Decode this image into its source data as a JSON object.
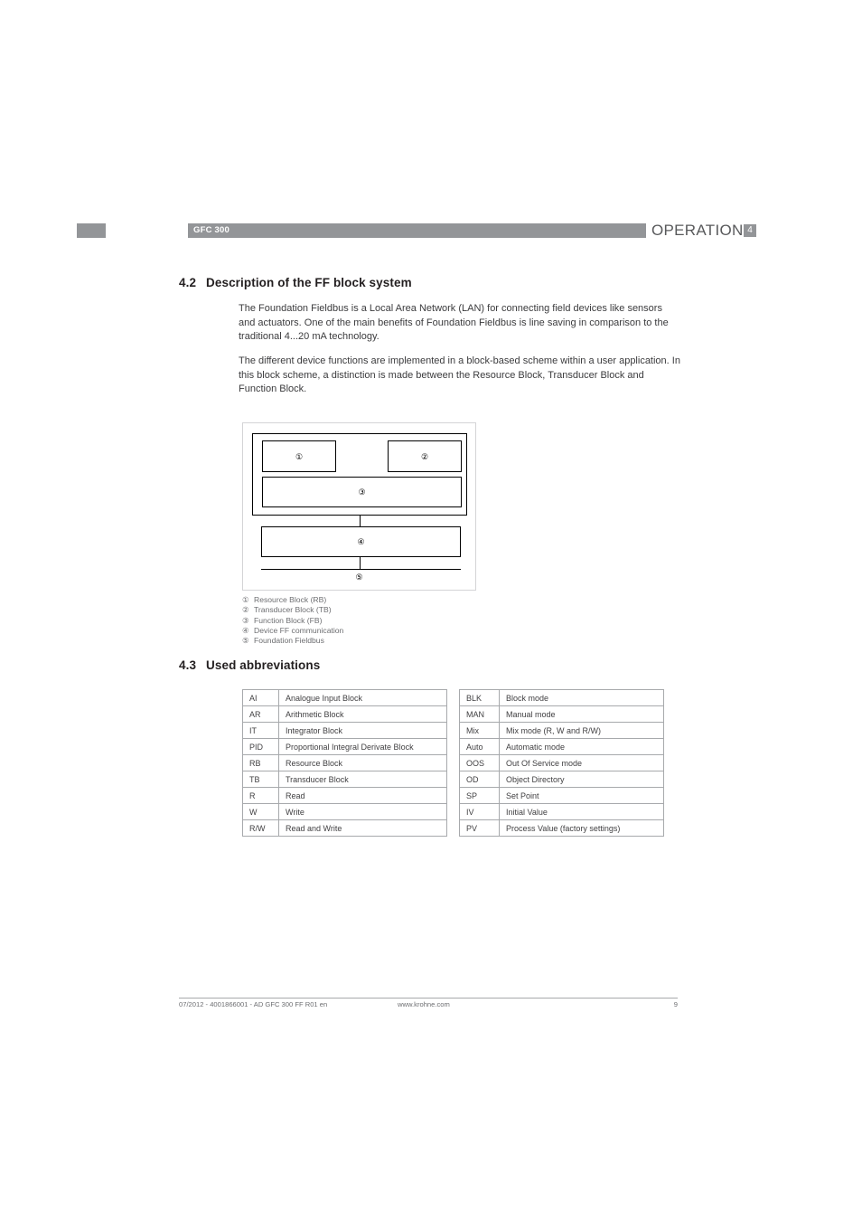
{
  "header": {
    "doc_title": "GFC 300",
    "section_title": "OPERATION",
    "chapter_number": "4",
    "bar_color": "#939598",
    "text_color": "#58595b"
  },
  "sections": {
    "s42": {
      "number": "4.2",
      "title": "Description of the FF block system",
      "paragraph_1": "The Foundation Fieldbus is a Local Area Network (LAN) for connecting field devices like sensors and actuators. One of the main benefits of Foundation Fieldbus is line saving in comparison to the traditional 4...20 mA technology.",
      "paragraph_2": "The different device functions are implemented in a block-based scheme within a user application. In this block scheme, a distinction is made between the Resource Block, Transducer Block and Function Block."
    },
    "s43": {
      "number": "4.3",
      "title": "Used abbreviations"
    }
  },
  "diagram": {
    "blocks": {
      "resource_block": "①",
      "transducer_block": "②",
      "function_block": "③",
      "device_ff_communication": "④",
      "foundation_fieldbus": "⑤"
    },
    "legend": [
      {
        "marker": "①",
        "label": "Resource Block (RB)"
      },
      {
        "marker": "②",
        "label": "Transducer Block (TB)"
      },
      {
        "marker": "③",
        "label": "Function Block (FB)"
      },
      {
        "marker": "④",
        "label": "Device FF communication"
      },
      {
        "marker": "⑤",
        "label": "Foundation Fieldbus"
      }
    ]
  },
  "abbreviations": {
    "left": [
      {
        "key": "AI",
        "value": "Analogue Input Block"
      },
      {
        "key": "AR",
        "value": "Arithmetic Block"
      },
      {
        "key": "IT",
        "value": "Integrator Block"
      },
      {
        "key": "PID",
        "value": "Proportional Integral Derivate Block"
      },
      {
        "key": "RB",
        "value": "Resource Block"
      },
      {
        "key": "TB",
        "value": "Transducer Block"
      },
      {
        "key": "R",
        "value": "Read"
      },
      {
        "key": "W",
        "value": "Write"
      },
      {
        "key": "R/W",
        "value": "Read and Write"
      }
    ],
    "right": [
      {
        "key": "BLK",
        "value": "Block mode"
      },
      {
        "key": "MAN",
        "value": "Manual mode"
      },
      {
        "key": "Mix",
        "value": "Mix mode (R, W and R/W)"
      },
      {
        "key": "Auto",
        "value": "Automatic mode"
      },
      {
        "key": "OOS",
        "value": "Out Of Service mode"
      },
      {
        "key": "OD",
        "value": "Object Directory"
      },
      {
        "key": "SP",
        "value": "Set Point"
      },
      {
        "key": "IV",
        "value": "Initial Value"
      },
      {
        "key": "PV",
        "value": "Process Value (factory settings)"
      }
    ]
  },
  "footer": {
    "left": "07/2012 - 4001866001 - AD GFC 300 FF R01 en",
    "center": "www.krohne.com",
    "page": "9"
  }
}
